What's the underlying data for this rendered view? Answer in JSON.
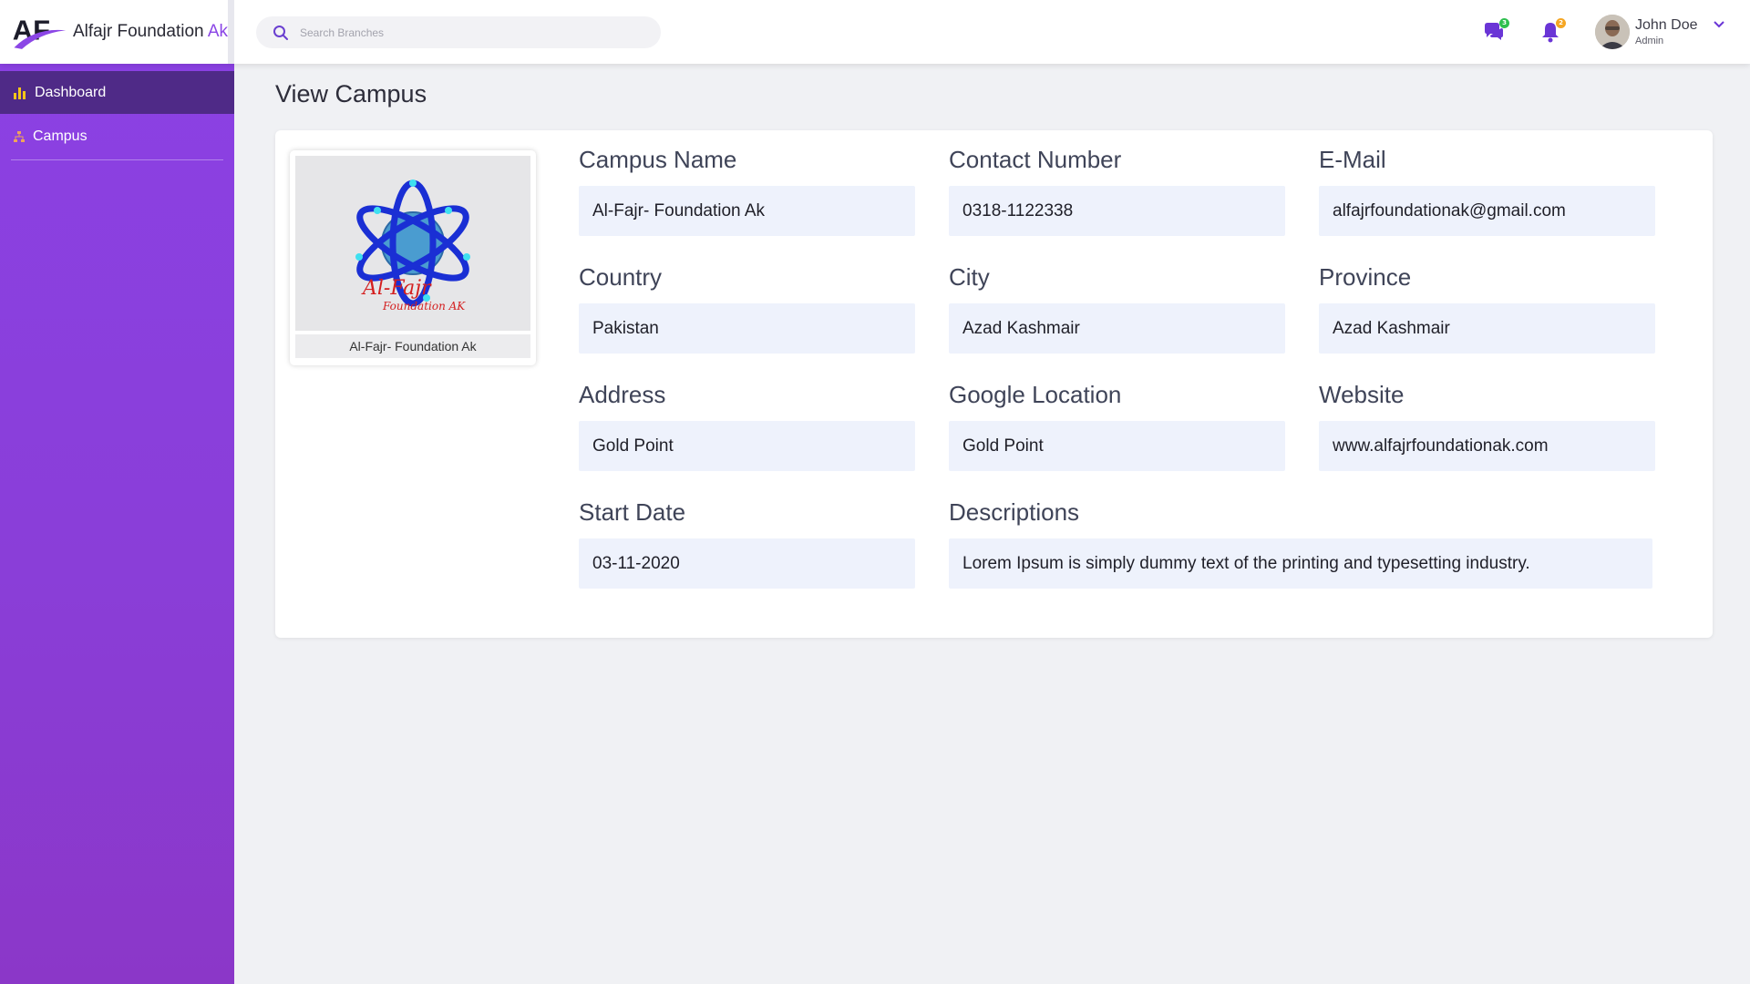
{
  "brand": {
    "name": "Alfajr Foundation ",
    "accent": "Ak",
    "logo_letters": "AF"
  },
  "header": {
    "search_placeholder": "Search Branches",
    "chat_badge": "3",
    "bell_badge": "2",
    "user_name": "John Doe",
    "user_role": "Admin"
  },
  "sidebar": {
    "items": [
      {
        "label": "Dashboard",
        "icon": "bar-chart-icon"
      },
      {
        "label": "Campus",
        "icon": "sitemap-icon"
      }
    ]
  },
  "page": {
    "title": "View Campus"
  },
  "campus": {
    "photo_caption": "Al-Fajr- Foundation Ak",
    "logo_text": "Al-Fajr",
    "logo_subtext": "Foundation AK",
    "fields": {
      "campus_name_label": "Campus Name",
      "campus_name": "Al-Fajr- Foundation Ak",
      "contact_label": "Contact Number",
      "contact": "0318-1122338",
      "email_label": "E-Mail",
      "email": "alfajrfoundationak@gmail.com",
      "country_label": "Country",
      "country": "Pakistan",
      "city_label": "City",
      "city": "Azad Kashmair",
      "province_label": "Province",
      "province": "Azad Kashmair",
      "address_label": "Address",
      "address": "Gold Point",
      "google_location_label": "Google Location",
      "google_location": "Gold Point",
      "website_label": "Website",
      "website": "www.alfajrfoundationak.com",
      "start_date_label": "Start Date",
      "start_date": "03-11-2020",
      "descriptions_label": "Descriptions",
      "descriptions": "Lorem Ipsum is simply dummy text of the printing and typesetting industry."
    }
  },
  "colors": {
    "accent": "#8b46e6",
    "sidebar_bg": "#8b41e3",
    "sidebar_active": "#4f2a87",
    "field_bg": "#eef2fc",
    "chat_badge": "#2fbf4f",
    "bell_badge": "#f5a623"
  }
}
